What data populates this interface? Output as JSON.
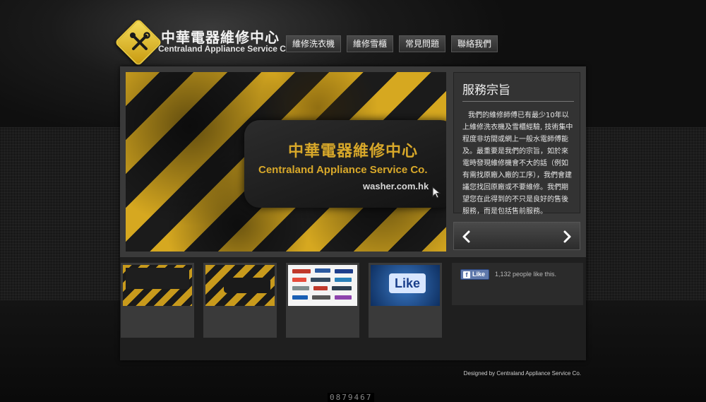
{
  "brand": {
    "name_cn": "中華電器維修中心",
    "name_en": "Centraland Appliance Service Co.",
    "logo_icon": "tools-icon"
  },
  "nav": {
    "items": [
      {
        "label": "維修洗衣機"
      },
      {
        "label": "維修雪櫃"
      },
      {
        "label": "常見問題"
      },
      {
        "label": "聯絡我們"
      }
    ]
  },
  "hero": {
    "title_cn": "中華電器維修中心",
    "title_en": "Centraland Appliance Service Co.",
    "url": "washer.com.hk"
  },
  "mission": {
    "title": "服務宗旨",
    "body": "我們的維修師傅已有最少10年以上維修洗衣機及雪櫃經驗, 技術集中程度非坊間或網上一般水電師傅能及。最重要是我們的宗旨，如於來電時發現維修機會不大的話（例如有需找原廠入廠的工序），我們會建議您找回原廠或不要維修。我們期望您在此得到的不只是良好的售後服務，而是包括售前服務。"
  },
  "slider": {
    "prev_icon": "chevron-left-icon",
    "next_icon": "chevron-right-icon"
  },
  "facebook": {
    "like_label": "Like",
    "count_text": "1,132 people like this."
  },
  "thumbs": {
    "like_text": "Like"
  },
  "footer": {
    "credit": "Designed by Centraland Appliance Service Co.",
    "counter": "0879467"
  },
  "colors": {
    "accent_gold": "#d8a82a",
    "background": "#0c0c0c",
    "facebook_blue": "#5f78ab"
  }
}
